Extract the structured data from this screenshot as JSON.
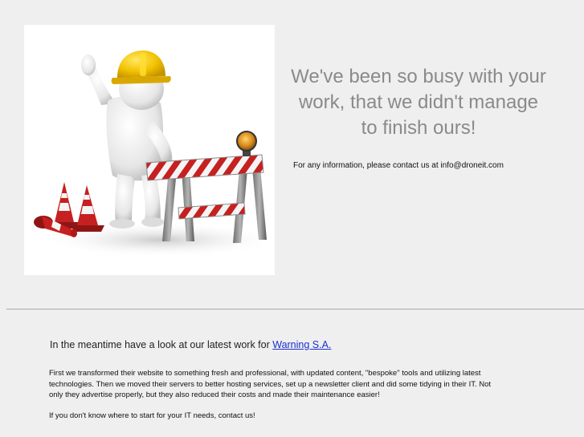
{
  "hero": {
    "headline": "We've been so busy with your work, that we didn't manage to finish ours!",
    "contact_text": "For any information, please contact us at info@droneit.com"
  },
  "showcase": {
    "intro_text": "In the meantime have a look at our latest work for ",
    "client_link_label": "Warning S.A.",
    "description": "First we transformed their website to something fresh and professional, with updated content, \"bespoke\" tools and utilizing latest technologies. Then we moved their servers to better hosting services, set up a newsletter client and did some tidying in their IT. Not only they advertise properly, but they also reduced their costs and made their maintenance easier!",
    "call_to_action": "If you don't know where to start for your IT needs, contact us!"
  },
  "colors": {
    "page_background": "#efefef",
    "headline_gray": "#8a8a8a",
    "link_blue": "#1a2fd0",
    "helmet_yellow": "#f2c200",
    "barrier_red": "#c62020"
  },
  "illustration": {
    "subject": "under-construction-worker-icon"
  }
}
